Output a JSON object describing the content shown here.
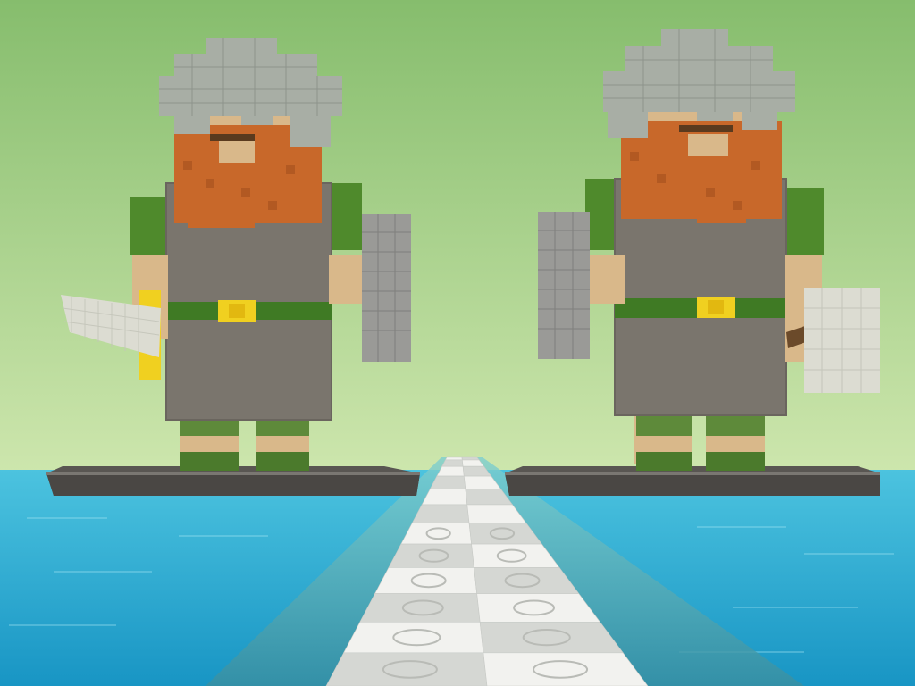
{
  "scene": {
    "type": "voxel-game-view",
    "statues": [
      {
        "name": "left-dwarf-statue",
        "facing": "right",
        "left_hand": "sword",
        "right_hand": "shield"
      },
      {
        "name": "right-dwarf-statue",
        "facing": "left",
        "left_hand": "shield",
        "right_hand": "axe"
      }
    ]
  },
  "colors": {
    "sky_top": "#8fc27a",
    "sky_horizon": "#c9e3a8",
    "water_far": "#3ab8d6",
    "water_near": "#1fa7cf",
    "helmet": "#a8aea5",
    "beard": "#c8682a",
    "skin": "#d9b88a",
    "tunic": "#7a756d",
    "sleeve": "#4f8a2c",
    "belt": "#3f7a24",
    "buckle": "#f0d020",
    "boot": "#5e8a3a",
    "stone": "#6e6b66",
    "bridge_tile_a": "#f2f2ef",
    "bridge_tile_b": "#d5d7d3"
  }
}
